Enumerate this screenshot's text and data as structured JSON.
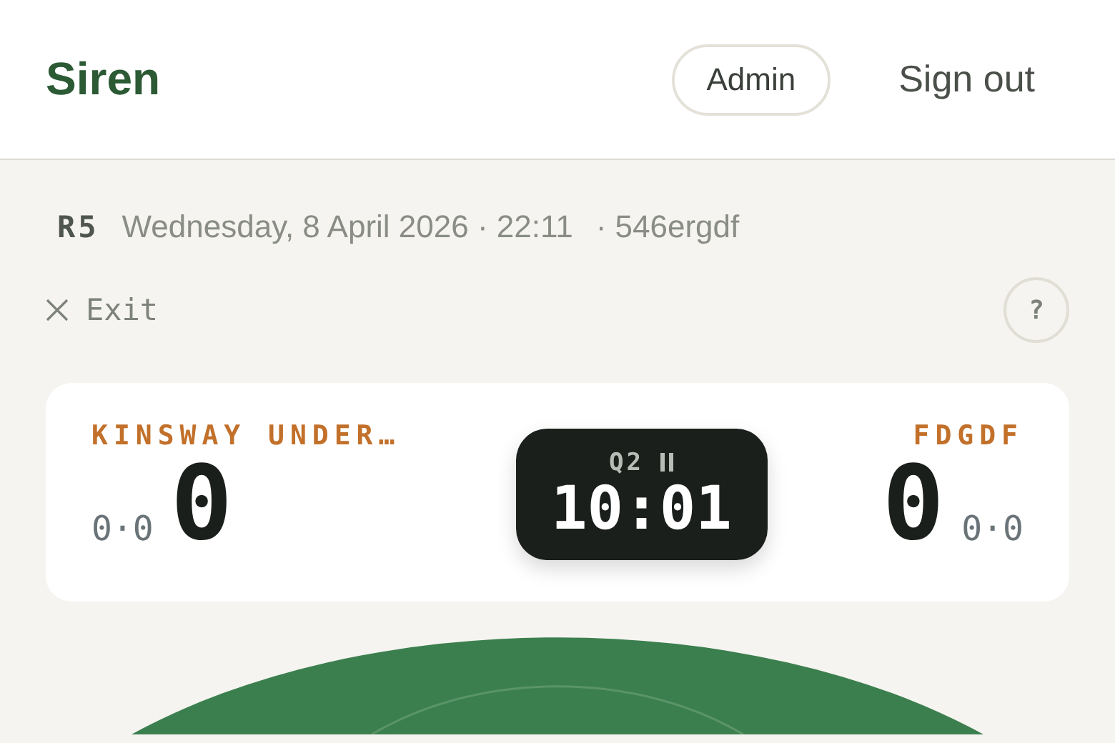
{
  "header": {
    "brand": "Siren",
    "admin_button": "Admin",
    "sign_out": "Sign out"
  },
  "meta": {
    "round": "R5",
    "datetime": "Wednesday, 8 April 2026 · 22:11",
    "code": "· 546ergdf"
  },
  "toolbar": {
    "exit": "Exit",
    "help": "?"
  },
  "scoreboard": {
    "home": {
      "name": "KINSWAY UNDER…",
      "score": "0",
      "breakdown": "0·0"
    },
    "away": {
      "name": "FDGDF",
      "score": "0",
      "breakdown": "0·0"
    },
    "clock": {
      "period": "Q2",
      "paused": true,
      "time": "10:01"
    }
  }
}
